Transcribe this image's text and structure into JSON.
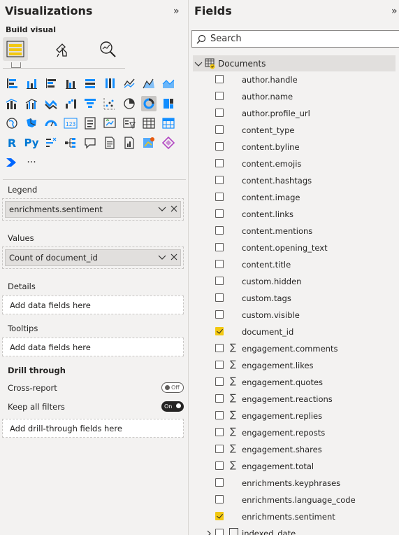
{
  "visualizations": {
    "title": "Visualizations",
    "collapse_icon": "»",
    "build_label": "Build visual",
    "more_label": "···",
    "r_label": "R",
    "py_label": "Py",
    "kpi_label": "123",
    "legend": {
      "label": "Legend",
      "field": "enrichments.sentiment"
    },
    "values": {
      "label": "Values",
      "field": "Count of document_id"
    },
    "details": {
      "label": "Details",
      "placeholder": "Add data fields here"
    },
    "tooltips": {
      "label": "Tooltips",
      "placeholder": "Add data fields here"
    },
    "drill": {
      "label": "Drill through",
      "cross_report": "Cross-report",
      "cross_report_state": "Off",
      "keep_filters": "Keep all filters",
      "keep_filters_state": "On",
      "placeholder": "Add drill-through fields here"
    }
  },
  "fields": {
    "title": "Fields",
    "collapse_icon": "»",
    "search_placeholder": "Search",
    "table_name": "Documents",
    "items": [
      {
        "name": "author.handle",
        "checked": false,
        "sigma": false
      },
      {
        "name": "author.name",
        "checked": false,
        "sigma": false
      },
      {
        "name": "author.profile_url",
        "checked": false,
        "sigma": false
      },
      {
        "name": "content_type",
        "checked": false,
        "sigma": false
      },
      {
        "name": "content.byline",
        "checked": false,
        "sigma": false
      },
      {
        "name": "content.emojis",
        "checked": false,
        "sigma": false
      },
      {
        "name": "content.hashtags",
        "checked": false,
        "sigma": false
      },
      {
        "name": "content.image",
        "checked": false,
        "sigma": false
      },
      {
        "name": "content.links",
        "checked": false,
        "sigma": false
      },
      {
        "name": "content.mentions",
        "checked": false,
        "sigma": false
      },
      {
        "name": "content.opening_text",
        "checked": false,
        "sigma": false
      },
      {
        "name": "content.title",
        "checked": false,
        "sigma": false
      },
      {
        "name": "custom.hidden",
        "checked": false,
        "sigma": false
      },
      {
        "name": "custom.tags",
        "checked": false,
        "sigma": false
      },
      {
        "name": "custom.visible",
        "checked": false,
        "sigma": false
      },
      {
        "name": "document_id",
        "checked": true,
        "sigma": false
      },
      {
        "name": "engagement.comments",
        "checked": false,
        "sigma": true
      },
      {
        "name": "engagement.likes",
        "checked": false,
        "sigma": true
      },
      {
        "name": "engagement.quotes",
        "checked": false,
        "sigma": true
      },
      {
        "name": "engagement.reactions",
        "checked": false,
        "sigma": true
      },
      {
        "name": "engagement.replies",
        "checked": false,
        "sigma": true
      },
      {
        "name": "engagement.reposts",
        "checked": false,
        "sigma": true
      },
      {
        "name": "engagement.shares",
        "checked": false,
        "sigma": true
      },
      {
        "name": "engagement.total",
        "checked": false,
        "sigma": true
      },
      {
        "name": "enrichments.keyphrases",
        "checked": false,
        "sigma": false
      },
      {
        "name": "enrichments.language_code",
        "checked": false,
        "sigma": false
      },
      {
        "name": "enrichments.sentiment",
        "checked": true,
        "sigma": false
      },
      {
        "name": "indexed_date",
        "checked": false,
        "sigma": false,
        "calendar": true,
        "expandable": true
      }
    ]
  },
  "colors": {
    "accent": "#f2c811",
    "pane_bg": "#f3f2f1",
    "selected_bg": "#e1dfdd"
  }
}
